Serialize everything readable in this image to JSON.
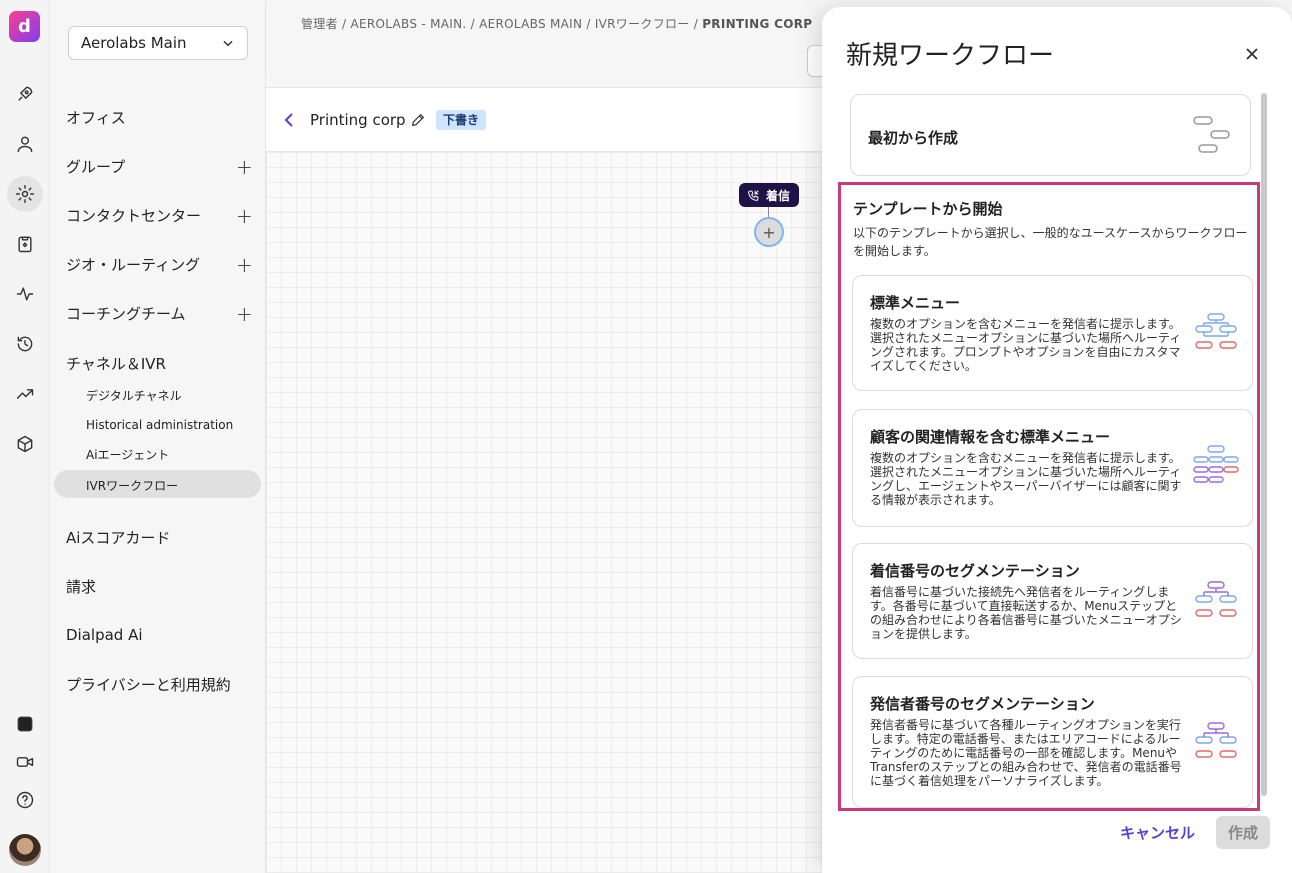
{
  "app": {
    "logo_letter": "d"
  },
  "sidebar": {
    "org_selector": "Aerolabs Main",
    "items": [
      {
        "label": "オフィス",
        "has_add": false
      },
      {
        "label": "グループ",
        "has_add": true
      },
      {
        "label": "コンタクトセンター",
        "has_add": true
      },
      {
        "label": "ジオ・ルーティング",
        "has_add": true
      },
      {
        "label": "コーチングチーム",
        "has_add": true
      },
      {
        "label": "チャネル＆IVR",
        "has_add": false
      },
      {
        "label": "Aiスコアカード",
        "has_add": false
      },
      {
        "label": "請求",
        "has_add": false
      },
      {
        "label": "Dialpad Ai",
        "has_add": false
      },
      {
        "label": "プライバシーと利用規約",
        "has_add": false
      }
    ],
    "sub_items": [
      "デジタルチャネル",
      "Historical administration",
      "Aiエージェント",
      "IVRワークフロー"
    ],
    "active_sub": "IVRワークフロー",
    "add_symbol": "+"
  },
  "breadcrumb": {
    "path": "管理者 / AEROLABS - MAIN. / AEROLABS MAIN / IVRワークフロー / ",
    "current": "PRINTING CORP"
  },
  "toolbar": {
    "workflow_name": "Printing corp",
    "status_badge": "下書き"
  },
  "canvas": {
    "incoming_node_label": "着信",
    "add_symbol": "+"
  },
  "modal": {
    "title": "新規ワークフロー",
    "scratch_label": "最初から作成",
    "templates_title": "テンプレートから開始",
    "templates_desc": "以下のテンプレートから選択し、一般的なユースケースからワークフローを開始します。",
    "templates": [
      {
        "title": "標準メニュー",
        "desc": "複数のオプションを含むメニューを発信者に提示します。選択されたメニューオプションに基づいた場所へルーティングされます。プロンプトやオプションを自由にカスタマイズしてください。"
      },
      {
        "title": "顧客の関連情報を含む標準メニュー",
        "desc": "複数のオプションを含むメニューを発信者に提示します。選択されたメニューオプションに基づいた場所へルーティングし、エージェントやスーパーバイザーには顧客に関する情報が表示されます。"
      },
      {
        "title": "着信番号のセグメンテーション",
        "desc": "着信番号に基づいた接続先へ発信者をルーティングします。各番号に基づいて直接転送するか、Menuステップとの組み合わせにより各着信番号に基づいたメニューオプションを提供します。"
      },
      {
        "title": "発信者番号のセグメンテーション",
        "desc": "発信者番号に基づいて各種ルーティングオプションを実行します。特定の電話番号、またはエリアコードによるルーティングのために電話番号の一部を確認します。MenuやTransferのステップとの組み合わせで、発信者の電話番号に基づく着信処理をパーソナライズします。"
      }
    ],
    "cancel_label": "キャンセル",
    "create_label": "作成"
  },
  "colors": {
    "accent": "#5a3fd6",
    "highlight_border": "#c83b78",
    "badge_bg": "#cfe5ff",
    "node_bg": "#1f1247"
  }
}
